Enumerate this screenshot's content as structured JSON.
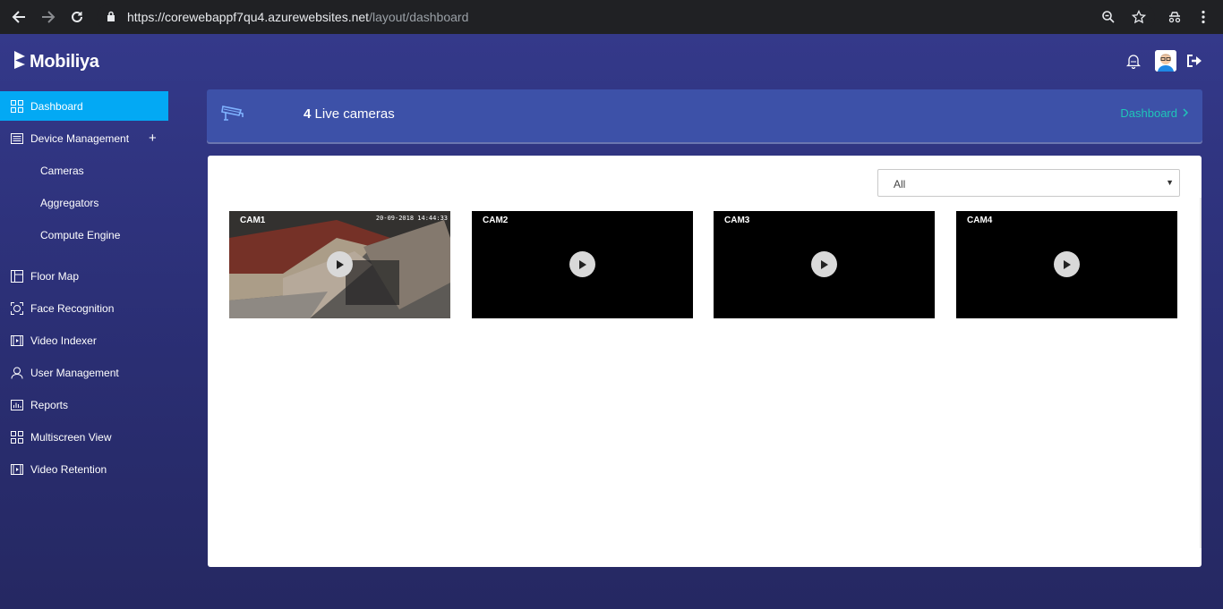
{
  "browser": {
    "url_host": "https://corewebappf7qu4.azurewebsites.net",
    "url_path": "/layout/dashboard"
  },
  "app": {
    "brand": "Mobiliya"
  },
  "sidebar": {
    "items": [
      {
        "label": "Dashboard",
        "icon": "grid-icon",
        "active": true
      },
      {
        "label": "Device Management",
        "icon": "list-icon",
        "expand": "+"
      },
      {
        "label": "Floor Map",
        "icon": "floormap-icon"
      },
      {
        "label": "Face Recognition",
        "icon": "face-scan-icon"
      },
      {
        "label": "Video Indexer",
        "icon": "film-icon"
      },
      {
        "label": "User Management",
        "icon": "user-icon"
      },
      {
        "label": "Reports",
        "icon": "bar-chart-icon"
      },
      {
        "label": "Multiscreen View",
        "icon": "grid-icon"
      },
      {
        "label": "Video Retention",
        "icon": "film-icon"
      }
    ],
    "subitems": [
      "Cameras",
      "Aggregators",
      "Compute Engine"
    ]
  },
  "banner": {
    "count": "4",
    "count_label": "Live cameras",
    "breadcrumb": "Dashboard"
  },
  "filter": {
    "selected": "All"
  },
  "cameras": [
    {
      "label": "CAM1",
      "stamp": "20-09-2018 14:44:33"
    },
    {
      "label": "CAM2"
    },
    {
      "label": "CAM3"
    },
    {
      "label": "CAM4"
    }
  ],
  "colors": {
    "active": "#03a9f4",
    "banner": "#3d51a8",
    "accent": "#1fc6b8"
  }
}
